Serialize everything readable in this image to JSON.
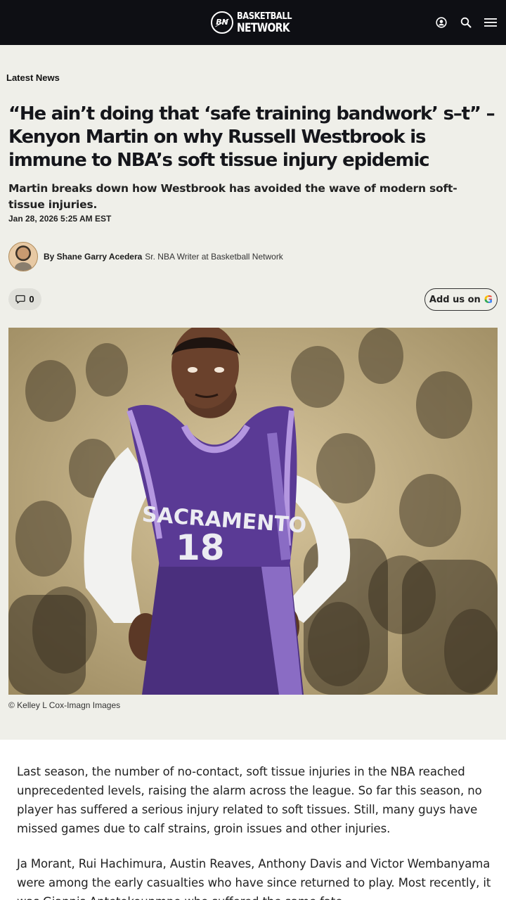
{
  "header": {
    "logo_monogram": "BN",
    "logo_line1": "BASKETBALL",
    "logo_line2": "NETWORK",
    "icons": [
      "user-icon",
      "search-icon",
      "menu-icon"
    ]
  },
  "article": {
    "category": "Latest News",
    "headline": "“He ain’t doing that ‘safe training bandwork’ s–t” – Kenyon Martin on why Russell Westbrook is immune to NBA’s soft tissue injury epidemic",
    "subhead": "Martin breaks down how Westbrook has avoided the wave of modern soft-tissue injuries.",
    "date": "Jan 28, 2026 5:25 AM EST",
    "author": {
      "byline": "By Shane Garry Acedera",
      "role": "Sr. NBA Writer at Basketball Network"
    },
    "comment_count": "0",
    "google_button_label": "Add us on",
    "image": {
      "jersey_team": "SACRAMENTO",
      "jersey_number": "18",
      "credit": "© Kelley L Cox-Imagn Images"
    },
    "paragraphs": [
      "Last season, the number of no-contact, soft tissue injuries in the NBA reached unprecedented levels, raising the alarm across the league. So far this season, no player has suffered a serious injury related to soft tissues. Still, many guys have missed games due to calf strains, groin issues and other injuries.",
      "Ja Morant, Rui Hachimura, Austin Reaves, Anthony Davis and Victor Wembanyama were among the early casualties who have since returned to play. Most recently, it was Giannis Antetokounmpo who suffered the same fate."
    ]
  },
  "colors": {
    "header_bg": "#0e0f14",
    "page_bg": "#efefe9",
    "jersey_purple": "#5a3a95"
  }
}
